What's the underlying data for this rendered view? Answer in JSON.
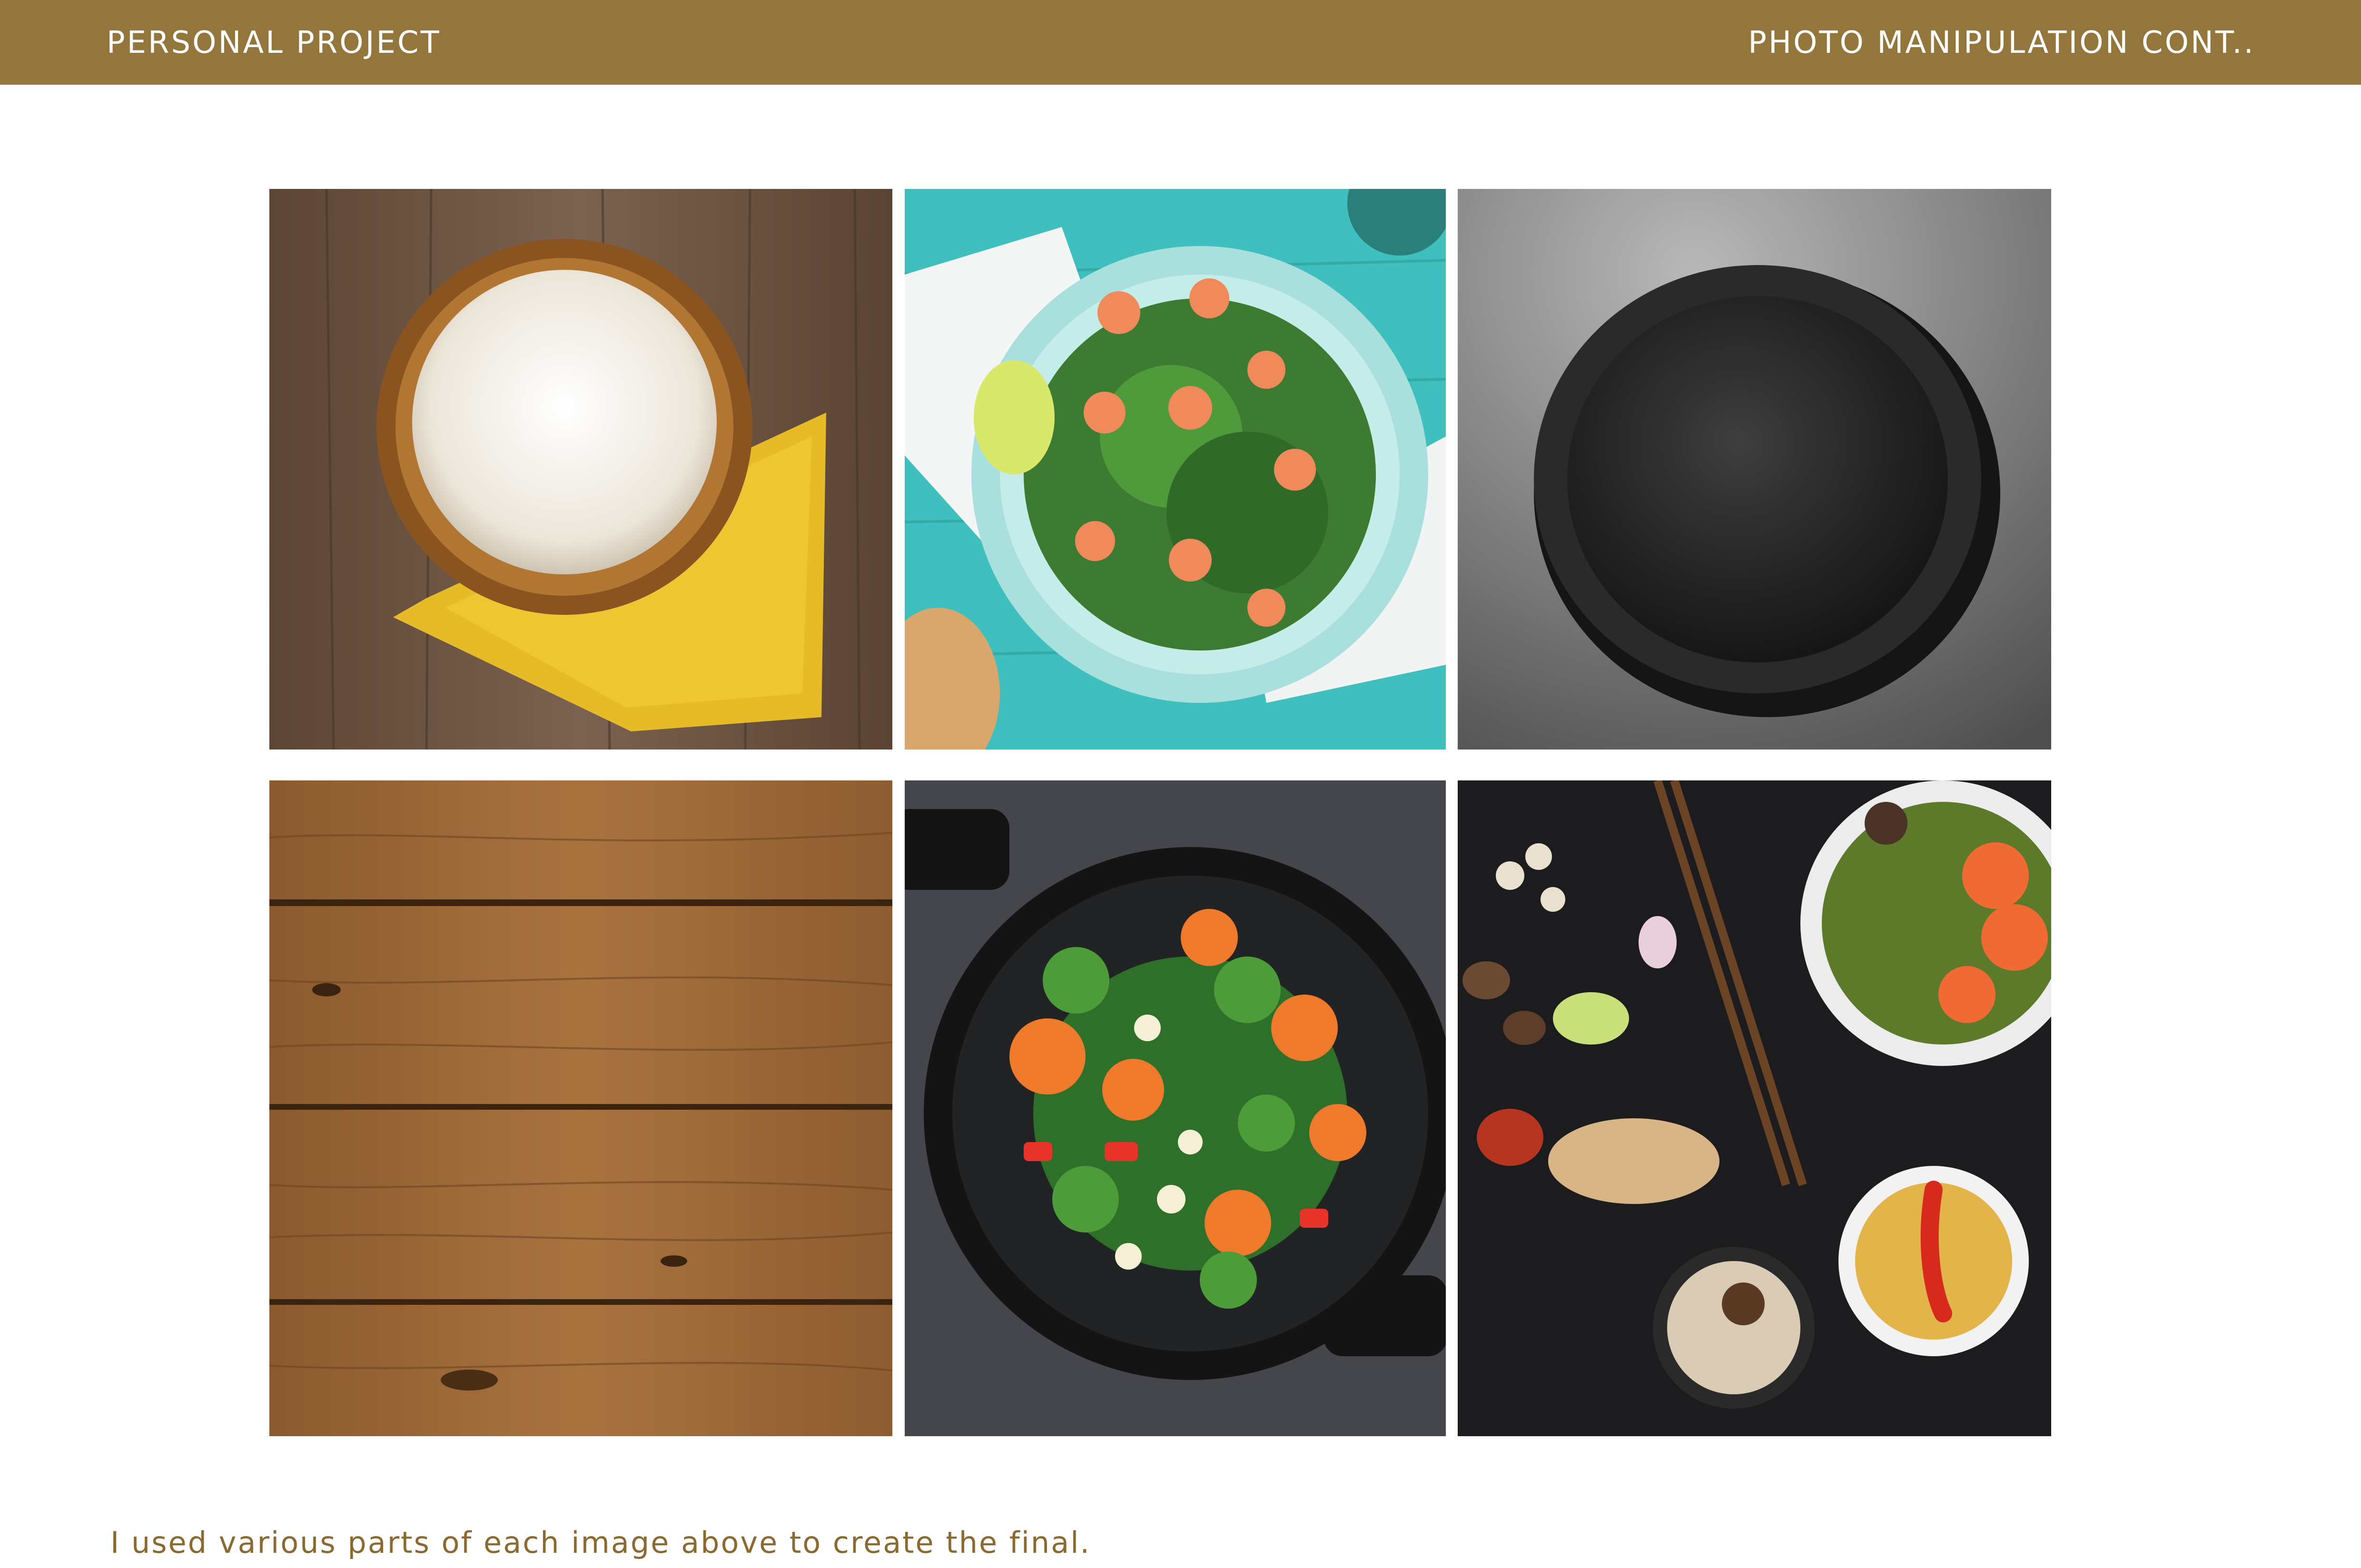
{
  "header": {
    "left_label": "PERSONAL PROJECT",
    "right_label": "PHOTO MANIPULATION CONT.."
  },
  "photos": [
    {
      "subject": "rice-bowl-photo"
    },
    {
      "subject": "shrimp-salad-photo"
    },
    {
      "subject": "empty-black-plate-photo"
    },
    {
      "subject": "wood-planks-photo"
    },
    {
      "subject": "vegetable-wok-photo"
    },
    {
      "subject": "asian-ingredients-photo"
    }
  ],
  "caption": "I used various parts of each image above to create the final.",
  "colors": {
    "header_bg": "#93763b",
    "header_text": "#ffffff",
    "caption_text": "#8b6a31"
  }
}
